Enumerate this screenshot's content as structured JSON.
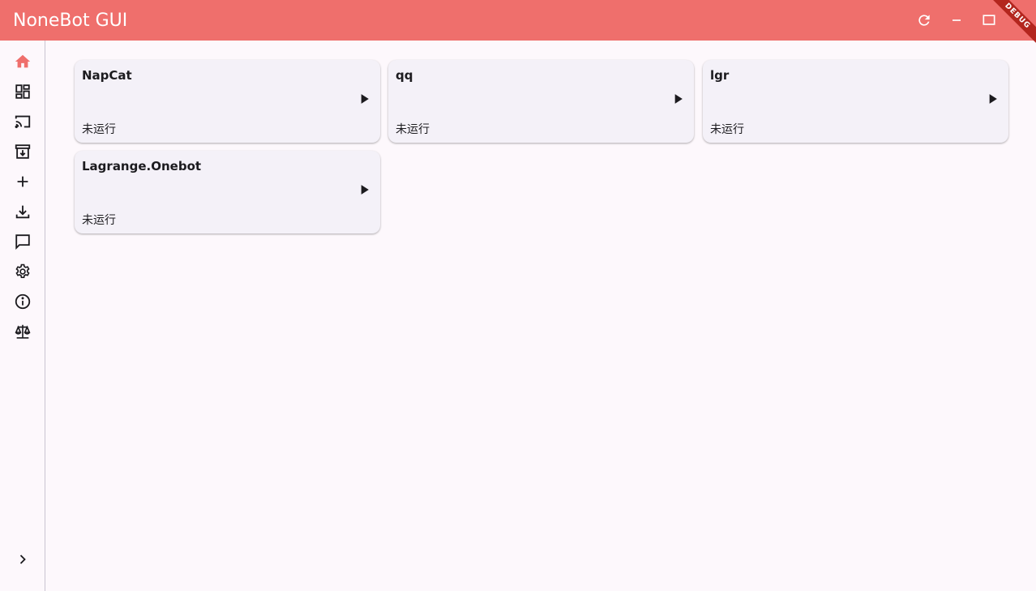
{
  "app": {
    "title": "NoneBot GUI",
    "accent_color": "#ef6f6c",
    "debug_banner": "DEBUG"
  },
  "titlebar": {
    "buttons": [
      {
        "name": "refresh-icon"
      },
      {
        "name": "minimize-icon"
      },
      {
        "name": "maximize-icon"
      }
    ]
  },
  "sidebar": {
    "items": [
      {
        "icon": "home-icon",
        "active": true
      },
      {
        "icon": "dashboard-icon"
      },
      {
        "icon": "cast-icon"
      },
      {
        "icon": "archive-download-icon"
      },
      {
        "icon": "add-icon"
      },
      {
        "icon": "download-icon"
      },
      {
        "icon": "chat-icon"
      },
      {
        "icon": "settings-icon"
      },
      {
        "icon": "info-icon"
      },
      {
        "icon": "balance-icon"
      }
    ],
    "expand_icon": "chevron-right-icon"
  },
  "bots": [
    {
      "name": "NapCat",
      "status": "未运行"
    },
    {
      "name": "qq",
      "status": "未运行"
    },
    {
      "name": "lgr",
      "status": "未运行"
    },
    {
      "name": "Lagrange.Onebot",
      "status": "未运行"
    }
  ]
}
